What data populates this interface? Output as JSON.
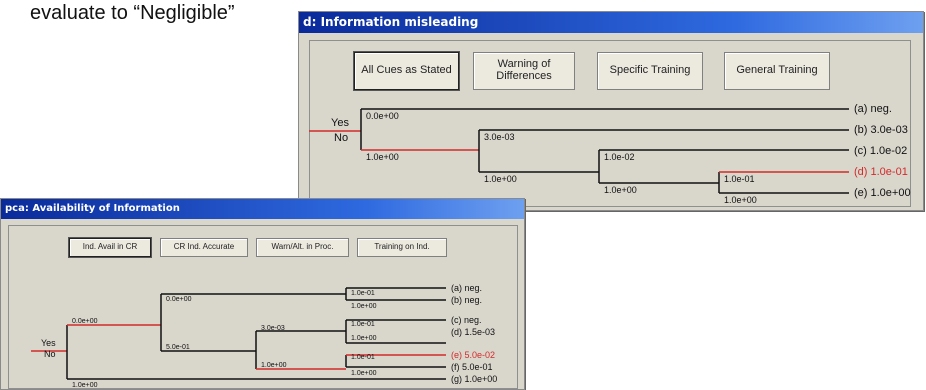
{
  "caption": "evaluate to “Negligible”",
  "colors": {
    "accent_red": "#d22b2b",
    "line": "#111111",
    "title_bg": "#1f4fc8"
  },
  "window_d": {
    "title": "d: Information misleading",
    "buttons": [
      {
        "label": "All Cues as Stated",
        "selected": true
      },
      {
        "label": "Warning of Differences",
        "selected": false
      },
      {
        "label": "Specific Training",
        "selected": false
      },
      {
        "label": "General Training",
        "selected": false
      }
    ],
    "tree": {
      "yes": "Yes",
      "no": "No",
      "values": [
        "0.0e+00",
        "1.0e+00",
        "3.0e-03",
        "1.0e+00",
        "1.0e-02",
        "1.0e+00",
        "1.0e-01",
        "1.0e+00"
      ],
      "outcomes": [
        "(a) neg.",
        "(b) 3.0e-03",
        "(c) 1.0e-02",
        "(d) 1.0e-01",
        "(e) 1.0e+00"
      ]
    }
  },
  "window_pca": {
    "title": "pca: Availability of Information",
    "buttons": [
      {
        "label": "Ind. Avail in CR",
        "selected": true
      },
      {
        "label": "CR Ind. Accurate",
        "selected": false
      },
      {
        "label": "Warn/Alt. in Proc.",
        "selected": false
      },
      {
        "label": "Training on Ind.",
        "selected": false
      }
    ],
    "tree": {
      "yes": "Yes",
      "no": "No",
      "values": [
        "0.0e+00",
        "1.0e+00",
        "0.0e+00",
        "5.0e-01",
        "1.0e-01",
        "1.0e+00",
        "3.0e-03",
        "1.0e+00",
        "1.0e-01",
        "1.0e+00",
        "1.0e-01",
        "1.0e+00"
      ],
      "outcomes": [
        "(a) neg.",
        "(b) neg.",
        "(c) neg.",
        "(d) 1.5e-03",
        "(e) 5.0e-02",
        "(f) 5.0e-01",
        "(g) 1.0e+00"
      ]
    }
  }
}
